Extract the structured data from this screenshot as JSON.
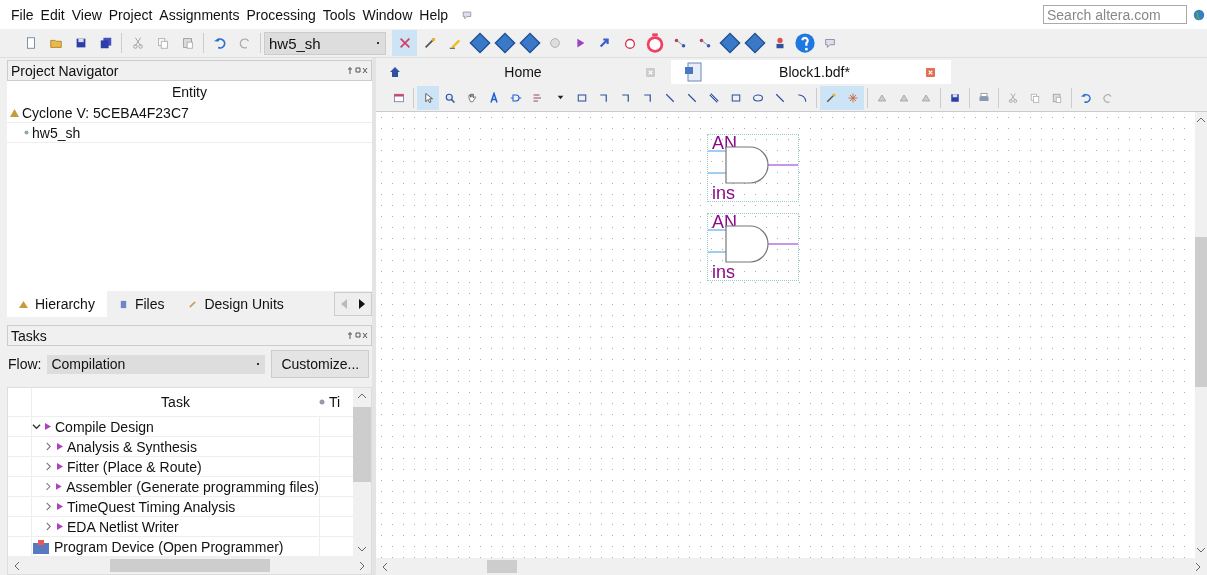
{
  "menu": [
    "File",
    "Edit",
    "View",
    "Project",
    "Assignments",
    "Processing",
    "Tools",
    "Window",
    "Help"
  ],
  "search": {
    "placeholder": "Search altera.com"
  },
  "main_toolbar": {
    "project": "hw5_sh",
    "tools": [
      {
        "kind": "new",
        "selected": false
      },
      {
        "kind": "open",
        "selected": false
      },
      {
        "kind": "save",
        "selected": false
      },
      {
        "kind": "save-all",
        "selected": false
      },
      {
        "kind": "cut",
        "selected": false
      },
      {
        "kind": "copy",
        "selected": false
      },
      {
        "kind": "paste",
        "selected": false
      },
      {
        "kind": "undo",
        "selected": false
      },
      {
        "kind": "redo",
        "selected": false
      }
    ],
    "tools_right": [
      {
        "kind": "compile",
        "selected": true
      },
      {
        "kind": "wand",
        "selected": false
      },
      {
        "kind": "pencil",
        "selected": false
      },
      {
        "kind": "diamond",
        "selected": false
      },
      {
        "kind": "diamond",
        "selected": false
      },
      {
        "kind": "diamond",
        "selected": false
      },
      {
        "kind": "stop",
        "selected": false
      },
      {
        "kind": "play",
        "selected": false
      },
      {
        "kind": "arrow",
        "selected": false
      },
      {
        "kind": "timer",
        "selected": false
      },
      {
        "kind": "stopwatch",
        "selected": false
      },
      {
        "kind": "net",
        "selected": false
      },
      {
        "kind": "net",
        "selected": false
      },
      {
        "kind": "diamond",
        "selected": false
      },
      {
        "kind": "diamond",
        "selected": false
      },
      {
        "kind": "chip",
        "selected": false
      },
      {
        "kind": "help",
        "selected": false
      },
      {
        "kind": "chat",
        "selected": false
      }
    ]
  },
  "navigator": {
    "title": "Project Navigator",
    "column": "Entity",
    "tree": [
      {
        "label": "Cyclone V: 5CEBA4F23C7",
        "children": [
          {
            "label": "hw5_sh"
          }
        ]
      }
    ],
    "tabs": [
      {
        "label": "Hierarchy",
        "selected": true
      },
      {
        "label": "Files",
        "selected": false
      },
      {
        "label": "Design Units",
        "selected": false
      }
    ]
  },
  "tasks": {
    "title": "Tasks",
    "flow_label": "Flow:",
    "flow": "Compilation",
    "customize": "Customize...",
    "columns": [
      "Task",
      "Ti"
    ],
    "tree": [
      {
        "label": "Compile Design",
        "expanded": true,
        "children": [
          {
            "label": "Analysis & Synthesis",
            "expanded": false
          },
          {
            "label": "Fitter (Place & Route)",
            "expanded": false
          },
          {
            "label": "Assembler (Generate programming files)",
            "expanded": false
          },
          {
            "label": "TimeQuest Timing Analysis",
            "expanded": false
          },
          {
            "label": "EDA Netlist Writer",
            "expanded": false
          }
        ]
      },
      {
        "label": "Program Device (Open Programmer)"
      }
    ]
  },
  "doc_tabs": [
    {
      "label": "Home",
      "selected": false
    },
    {
      "label": "Block1.bdf*",
      "selected": true
    }
  ],
  "editor_tools": [
    {
      "kind": "window",
      "selected": false
    },
    {
      "kind": "select",
      "selected": true
    },
    {
      "kind": "zoom",
      "selected": false
    },
    {
      "kind": "hand",
      "selected": false
    },
    {
      "kind": "text",
      "selected": false
    },
    {
      "kind": "symbol",
      "selected": false
    },
    {
      "kind": "pin",
      "selected": false
    },
    {
      "kind": "dropdown",
      "selected": false
    },
    {
      "kind": "rect",
      "selected": false
    },
    {
      "kind": "corner",
      "selected": false
    },
    {
      "kind": "corner",
      "selected": false
    },
    {
      "kind": "corner",
      "selected": false
    },
    {
      "kind": "line",
      "selected": false
    },
    {
      "kind": "line",
      "selected": false
    },
    {
      "kind": "bus",
      "selected": false
    },
    {
      "kind": "rect",
      "selected": false
    },
    {
      "kind": "oval",
      "selected": false
    },
    {
      "kind": "line",
      "selected": false
    },
    {
      "kind": "arc",
      "selected": false
    },
    {
      "kind": "wand",
      "selected": true
    },
    {
      "kind": "spark",
      "selected": true
    },
    {
      "kind": "flip",
      "selected": false
    },
    {
      "kind": "flip",
      "selected": false
    },
    {
      "kind": "flip",
      "selected": false
    },
    {
      "kind": "save",
      "selected": false
    },
    {
      "kind": "print",
      "selected": false
    },
    {
      "kind": "cut",
      "selected": false
    },
    {
      "kind": "copy",
      "selected": false
    },
    {
      "kind": "paste",
      "selected": false
    },
    {
      "kind": "undo",
      "selected": false
    },
    {
      "kind": "redo",
      "selected": false
    }
  ],
  "canvas": {
    "gates": [
      {
        "name": "AN",
        "instance": "ins"
      },
      {
        "name": "AN",
        "instance": "ins"
      }
    ]
  }
}
